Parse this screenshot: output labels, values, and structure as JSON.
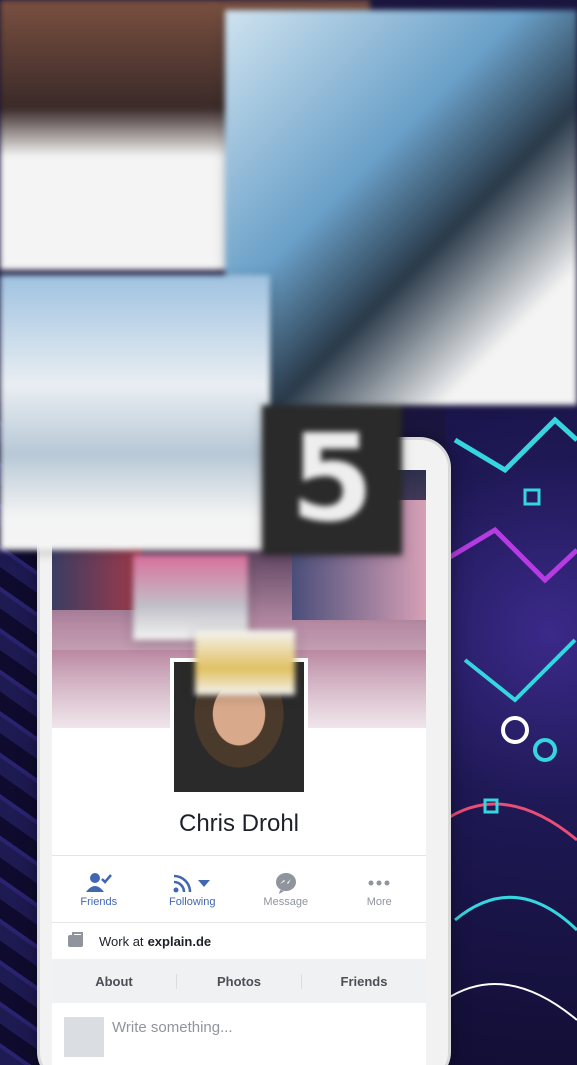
{
  "profile": {
    "name": "Chris Drohl",
    "work_prefix": "Work at ",
    "work_company": "explain.de"
  },
  "actions": [
    {
      "label": "Friends",
      "icon": "friend-check-icon",
      "state": "active"
    },
    {
      "label": "Following",
      "icon": "rss-follow-icon",
      "state": "active"
    },
    {
      "label": "Message",
      "icon": "messenger-icon",
      "state": "inactive"
    },
    {
      "label": "More",
      "icon": "more-dots-icon",
      "state": "inactive"
    }
  ],
  "tabs": [
    "About",
    "Photos",
    "Friends"
  ],
  "composer": {
    "placeholder": "Write something..."
  },
  "overlay": {
    "digit": "5"
  },
  "colors": {
    "accent": "#4267b2",
    "muted": "#90949c",
    "text": "#1d2129"
  }
}
